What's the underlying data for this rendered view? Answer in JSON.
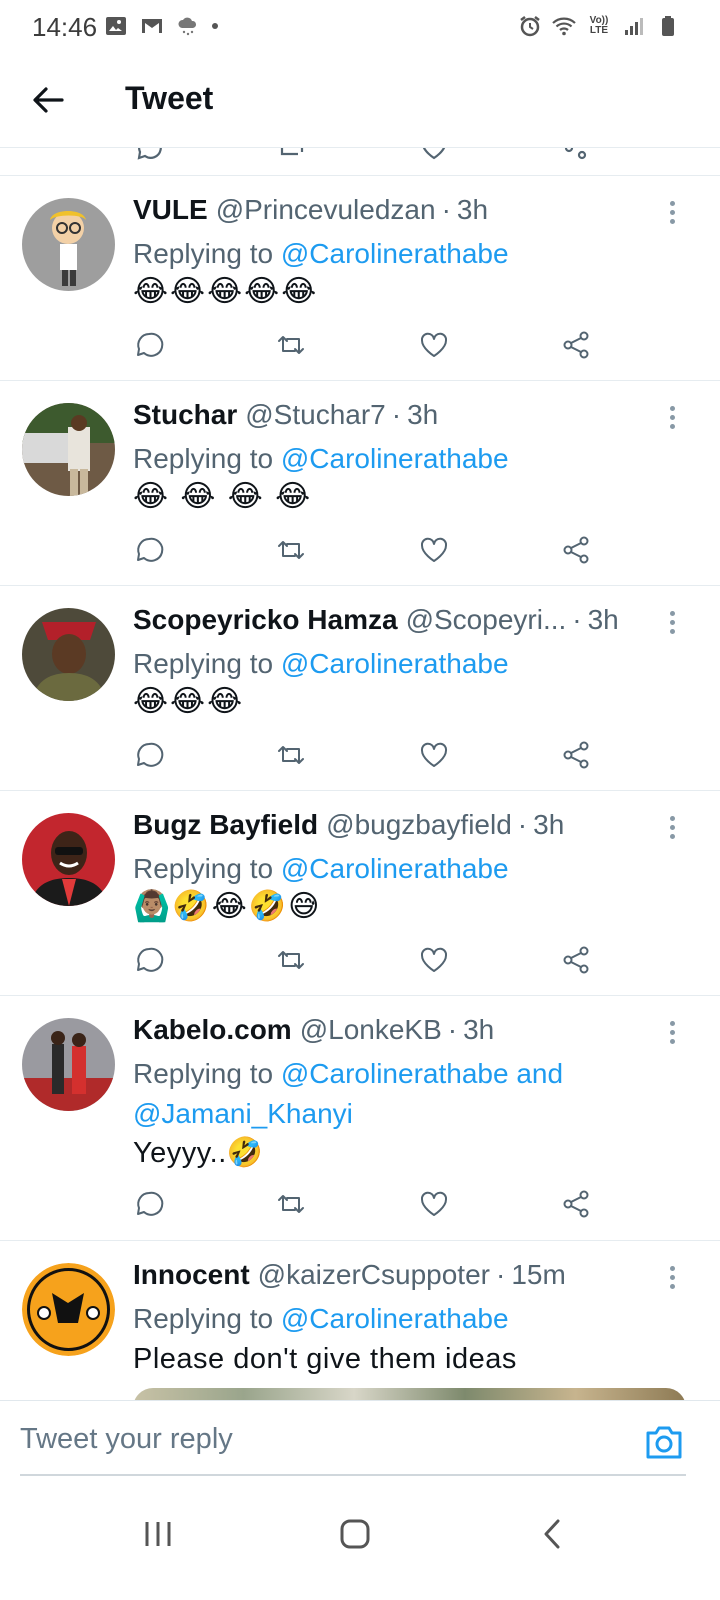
{
  "status_bar": {
    "time": "14:46",
    "left_icons": [
      "image-icon",
      "gmail-icon",
      "weather-icon"
    ],
    "right_icons": [
      "alarm-icon",
      "wifi-icon",
      "volte-icon",
      "signal-icon",
      "battery-icon"
    ],
    "volte_label": "Vo)) LTE"
  },
  "header": {
    "title": "Tweet"
  },
  "tweets": [
    {
      "name": "VULE",
      "handle": "@Princevuledzan",
      "time": "3h",
      "replying_prefix": "Replying to ",
      "mentions": "@Carolinerathabe",
      "text": "😂😂😂😂😂"
    },
    {
      "name": "Stuchar",
      "handle": "@Stuchar7",
      "time": "3h",
      "replying_prefix": "Replying to ",
      "mentions": "@Carolinerathabe",
      "text": "😂 😂 😂 😂"
    },
    {
      "name": "Scopeyricko Hamza",
      "handle": "@Scopeyri...",
      "time": "3h",
      "replying_prefix": "Replying to ",
      "mentions": "@Carolinerathabe",
      "text": "😂😂😂"
    },
    {
      "name": "Bugz Bayfield",
      "handle": "@bugzbayfield",
      "time": "3h",
      "replying_prefix": "Replying to ",
      "mentions": "@Carolinerathabe",
      "text": "🙆🏽‍♂️🤣😂🤣😅"
    },
    {
      "name": "Kabelo.com",
      "handle": "@LonkeKB",
      "time": "3h",
      "replying_prefix": "Replying to ",
      "mentions": "@Carolinerathabe and @Jamani_Khanyi",
      "text": "Yeyyy..🤣"
    },
    {
      "name": "Innocent",
      "handle": "@kaizerCsuppoter",
      "time": "15m",
      "replying_prefix": "Replying to ",
      "mentions": "@Carolinerathabe",
      "text": "Please don't give them ideas"
    }
  ],
  "composer": {
    "placeholder": "Tweet your reply"
  },
  "nav_bar": {
    "buttons": [
      "recents-icon",
      "home-icon",
      "back-icon"
    ]
  },
  "colors": {
    "accent": "#1d9bf0",
    "secondary_text": "#536471",
    "primary_text": "#0f1419",
    "divider": "#e6ecf0"
  }
}
